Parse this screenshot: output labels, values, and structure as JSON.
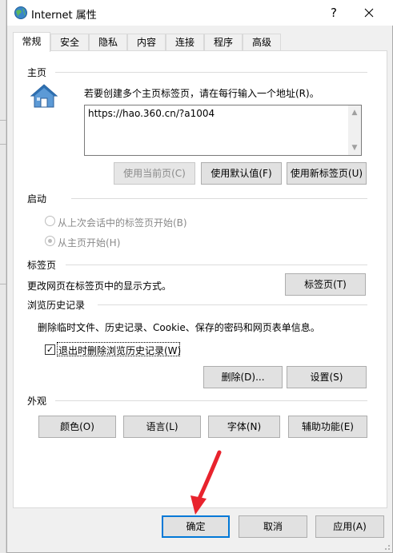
{
  "window": {
    "title": "Internet 属性",
    "help": "?",
    "close": "✕"
  },
  "tabs": [
    "常规",
    "安全",
    "隐私",
    "内容",
    "连接",
    "程序",
    "高级"
  ],
  "homepage": {
    "section": "主页",
    "instruction": "若要创建多个主页标签页，请在每行输入一个地址(R)。",
    "url": "https://hao.360.cn/?a1004",
    "use_current": "使用当前页(C)",
    "use_default": "使用默认值(F)",
    "use_new_tab": "使用新标签页(U)"
  },
  "startup": {
    "section": "启动",
    "option_last_session": "从上次会话中的标签页开始(B)",
    "option_homepage": "从主页开始(H)",
    "selected": "option_homepage"
  },
  "tabs_section": {
    "section": "标签页",
    "description": "更改网页在标签页中的显示方式。",
    "button": "标签页(T)"
  },
  "history": {
    "section": "浏览历史记录",
    "description": "删除临时文件、历史记录、Cookie、保存的密码和网页表单信息。",
    "delete_on_exit": "退出时删除浏览历史记录(W)",
    "delete_on_exit_checked": true,
    "delete_button": "删除(D)...",
    "settings_button": "设置(S)"
  },
  "appearance": {
    "section": "外观",
    "colors": "颜色(O)",
    "languages": "语言(L)",
    "fonts": "字体(N)",
    "accessibility": "辅助功能(E)"
  },
  "footer": {
    "ok": "确定",
    "cancel": "取消",
    "apply": "应用(A)"
  },
  "colors": {
    "accent": "#0078d7",
    "arrow": "#e8232d",
    "house_blue": "#3f7fc4"
  }
}
